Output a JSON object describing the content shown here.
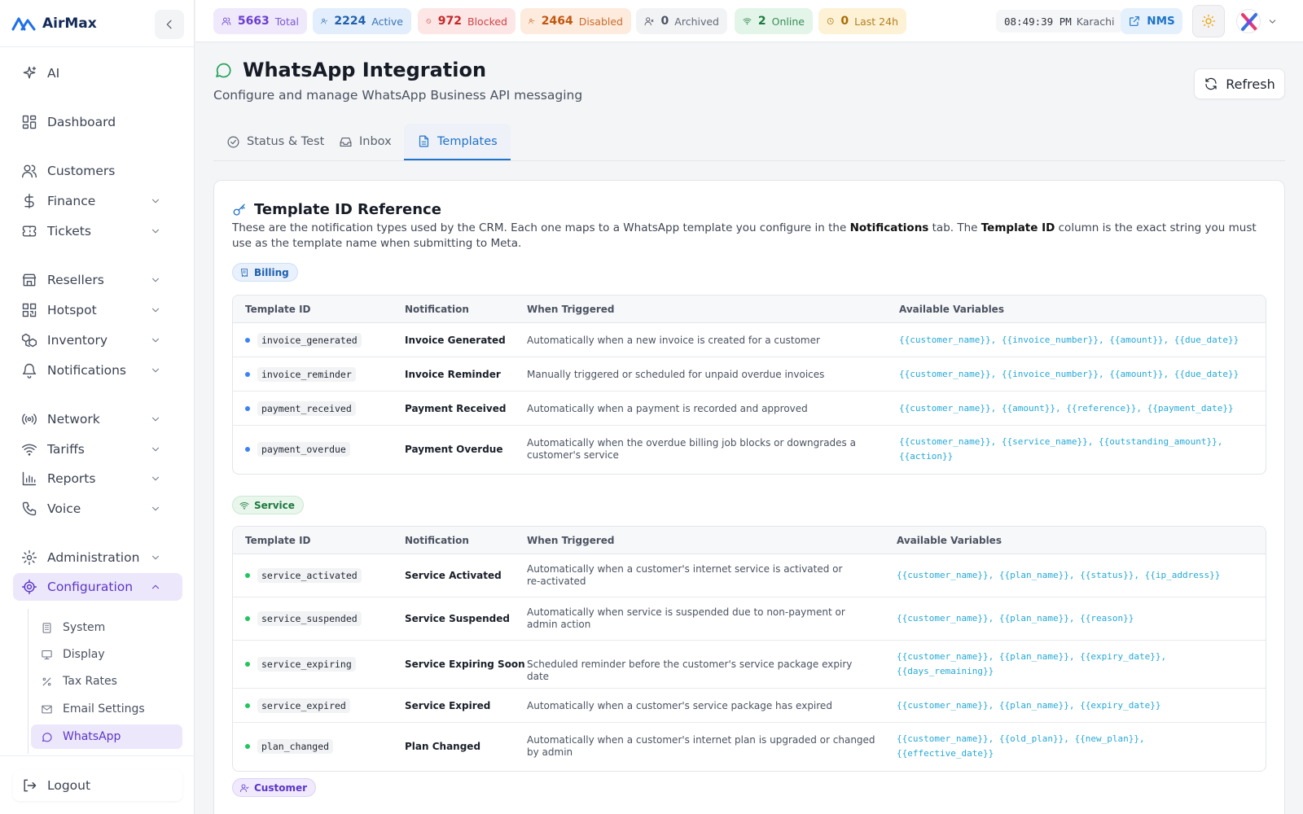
{
  "app": {
    "name": "AirMax"
  },
  "sidebar": {
    "items": [
      {
        "label": "AI"
      },
      {
        "label": "Dashboard"
      },
      {
        "label": "Customers"
      },
      {
        "label": "Finance"
      },
      {
        "label": "Tickets"
      },
      {
        "label": "Resellers"
      },
      {
        "label": "Hotspot"
      },
      {
        "label": "Inventory"
      },
      {
        "label": "Notifications"
      },
      {
        "label": "Network"
      },
      {
        "label": "Tariffs"
      },
      {
        "label": "Reports"
      },
      {
        "label": "Voice"
      },
      {
        "label": "Administration"
      },
      {
        "label": "Configuration"
      }
    ],
    "sub_items": [
      {
        "label": "System"
      },
      {
        "label": "Display"
      },
      {
        "label": "Tax Rates"
      },
      {
        "label": "Email Settings"
      },
      {
        "label": "WhatsApp"
      }
    ],
    "logout_label": "Logout"
  },
  "topbar": {
    "stats": [
      {
        "value": "5663",
        "label": "Total"
      },
      {
        "value": "2224",
        "label": "Active"
      },
      {
        "value": "972",
        "label": "Blocked"
      },
      {
        "value": "2464",
        "label": "Disabled"
      },
      {
        "value": "0",
        "label": "Archived"
      },
      {
        "value": "2",
        "label": "Online"
      },
      {
        "value": "0",
        "label": "Last 24h"
      }
    ],
    "time": "08:49:39 PM",
    "timezone": "Karachi",
    "nms_label": "NMS"
  },
  "page": {
    "title": "WhatsApp Integration",
    "subtitle": "Configure and manage WhatsApp Business API messaging",
    "refresh_label": "Refresh"
  },
  "tabs": [
    {
      "label": "Status & Test"
    },
    {
      "label": "Inbox"
    },
    {
      "label": "Templates"
    }
  ],
  "reference": {
    "title": "Template ID Reference",
    "desc_1": "These are the notification types used by the CRM. Each one maps to a WhatsApp template you configure in the ",
    "desc_bold_1": "Notifications",
    "desc_2": " tab. The ",
    "desc_bold_2": "Template ID",
    "desc_3": " column is the exact string you must use as the template name when submitting to Meta.",
    "columns": {
      "template_id": "Template ID",
      "notification": "Notification",
      "when": "When Triggered",
      "vars": "Available Variables"
    },
    "groups": [
      {
        "name": "Billing",
        "rows": [
          {
            "id": "invoice_generated",
            "notification": "Invoice Generated",
            "when": "Automatically when a new invoice is created for a customer",
            "vars": "{{customer_name}}, {{invoice_number}}, {{amount}}, {{due_date}}"
          },
          {
            "id": "invoice_reminder",
            "notification": "Invoice Reminder",
            "when": "Manually triggered or scheduled for unpaid overdue invoices",
            "vars": "{{customer_name}}, {{invoice_number}}, {{amount}}, {{due_date}}"
          },
          {
            "id": "payment_received",
            "notification": "Payment Received",
            "when": "Automatically when a payment is recorded and approved",
            "vars": "{{customer_name}}, {{amount}}, {{reference}}, {{payment_date}}"
          },
          {
            "id": "payment_overdue",
            "notification": "Payment Overdue",
            "when": "Automatically when the overdue billing job blocks or downgrades a customer's service",
            "vars": "{{customer_name}}, {{service_name}}, {{outstanding_amount}}, {{action}}"
          }
        ]
      },
      {
        "name": "Service",
        "rows": [
          {
            "id": "service_activated",
            "notification": "Service Activated",
            "when": "Automatically when a customer's internet service is activated or re-activated",
            "vars": "{{customer_name}}, {{plan_name}}, {{status}}, {{ip_address}}"
          },
          {
            "id": "service_suspended",
            "notification": "Service Suspended",
            "when": "Automatically when service is suspended due to non-payment or admin action",
            "vars": "{{customer_name}}, {{plan_name}}, {{reason}}"
          },
          {
            "id": "service_expiring",
            "notification": "Service Expiring Soon",
            "when": "Scheduled reminder before the customer's service package expiry date",
            "vars": "{{customer_name}}, {{plan_name}}, {{expiry_date}}, {{days_remaining}}"
          },
          {
            "id": "service_expired",
            "notification": "Service Expired",
            "when": "Automatically when a customer's service package has expired",
            "vars": "{{customer_name}}, {{plan_name}}, {{expiry_date}}"
          },
          {
            "id": "plan_changed",
            "notification": "Plan Changed",
            "when": "Automatically when a customer's internet plan is upgraded or changed by admin",
            "vars": "{{customer_name}}, {{old_plan}}, {{new_plan}}, {{effective_date}}"
          }
        ]
      },
      {
        "name": "Customer",
        "rows": []
      }
    ]
  },
  "colors": {
    "accent": "#1f73c9",
    "nav_active_bg": "#ece7fb",
    "nav_active_fg": "#5b35c9",
    "whatsapp_green": "#22a35a",
    "variable_text": "#25a8d6"
  }
}
